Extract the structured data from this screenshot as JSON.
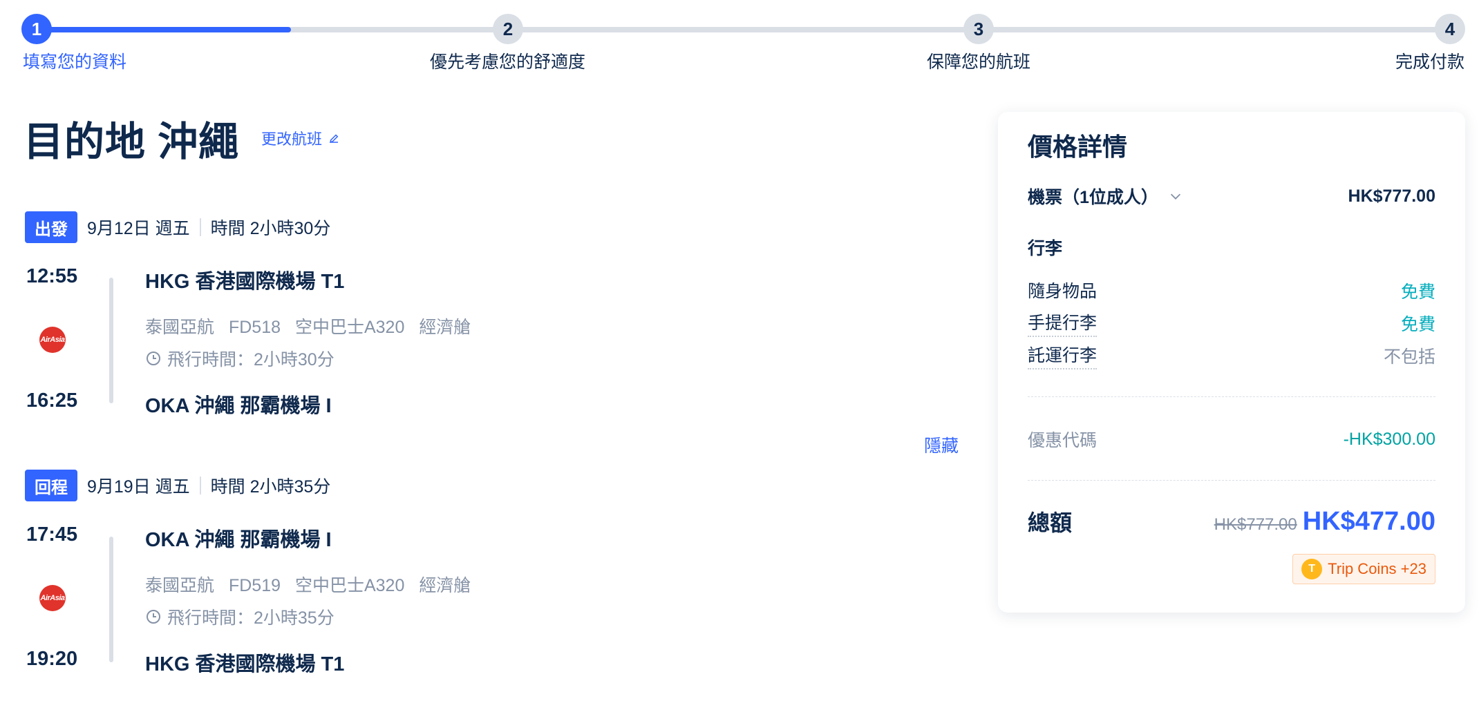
{
  "stepper": {
    "progress_fraction": 0.18,
    "steps": [
      {
        "number": "1",
        "label": "填寫您的資料",
        "active": true
      },
      {
        "number": "2",
        "label": "優先考慮您的舒適度",
        "active": false
      },
      {
        "number": "3",
        "label": "保障您的航班",
        "active": false
      },
      {
        "number": "4",
        "label": "完成付款",
        "active": false
      }
    ]
  },
  "header": {
    "title": "目的地 沖繩",
    "change_flight": "更改航班"
  },
  "itinerary": {
    "hide_label": "隱藏",
    "segments": [
      {
        "badge": "出發",
        "date": "9月12日 週五",
        "duration": "時間 2小時30分",
        "dep_time": "12:55",
        "dep_airport": "HKG 香港國際機場 T1",
        "airline": "泰國亞航",
        "flight_no": "FD518",
        "aircraft": "空中巴士A320",
        "cabin": "經濟艙",
        "fly_time": "飛行時間：2小時30分",
        "arr_time": "16:25",
        "arr_airport": "OKA 沖繩 那霸機場 I",
        "logo_text": "AirAsia"
      },
      {
        "badge": "回程",
        "date": "9月19日 週五",
        "duration": "時間 2小時35分",
        "dep_time": "17:45",
        "dep_airport": "OKA 沖繩 那霸機場 I",
        "airline": "泰國亞航",
        "flight_no": "FD519",
        "aircraft": "空中巴士A320",
        "cabin": "經濟艙",
        "fly_time": "飛行時間：2小時35分",
        "arr_time": "19:20",
        "arr_airport": "HKG 香港國際機場 T1",
        "logo_text": "AirAsia"
      }
    ]
  },
  "price": {
    "title": "價格詳情",
    "ticket_label": "機票（1位成人）",
    "ticket_price": "HK$777.00",
    "baggage_title": "行李",
    "baggage": [
      {
        "label": "隨身物品",
        "value": "免費",
        "kind": "free"
      },
      {
        "label": "手提行李",
        "value": "免費",
        "kind": "free"
      },
      {
        "label": "託運行李",
        "value": "不包括",
        "kind": "excluded"
      }
    ],
    "promo_label": "優惠代碼",
    "promo_value": "-HK$300.00",
    "total_label": "總額",
    "old_total": "HK$777.00",
    "total": "HK$477.00",
    "coins_label": "Trip Coins +23",
    "coin_glyph": "T"
  },
  "colors": {
    "accent": "#3264ff",
    "free": "#06aebd",
    "promo": "#00a3a3",
    "coins": "#e8590c"
  }
}
